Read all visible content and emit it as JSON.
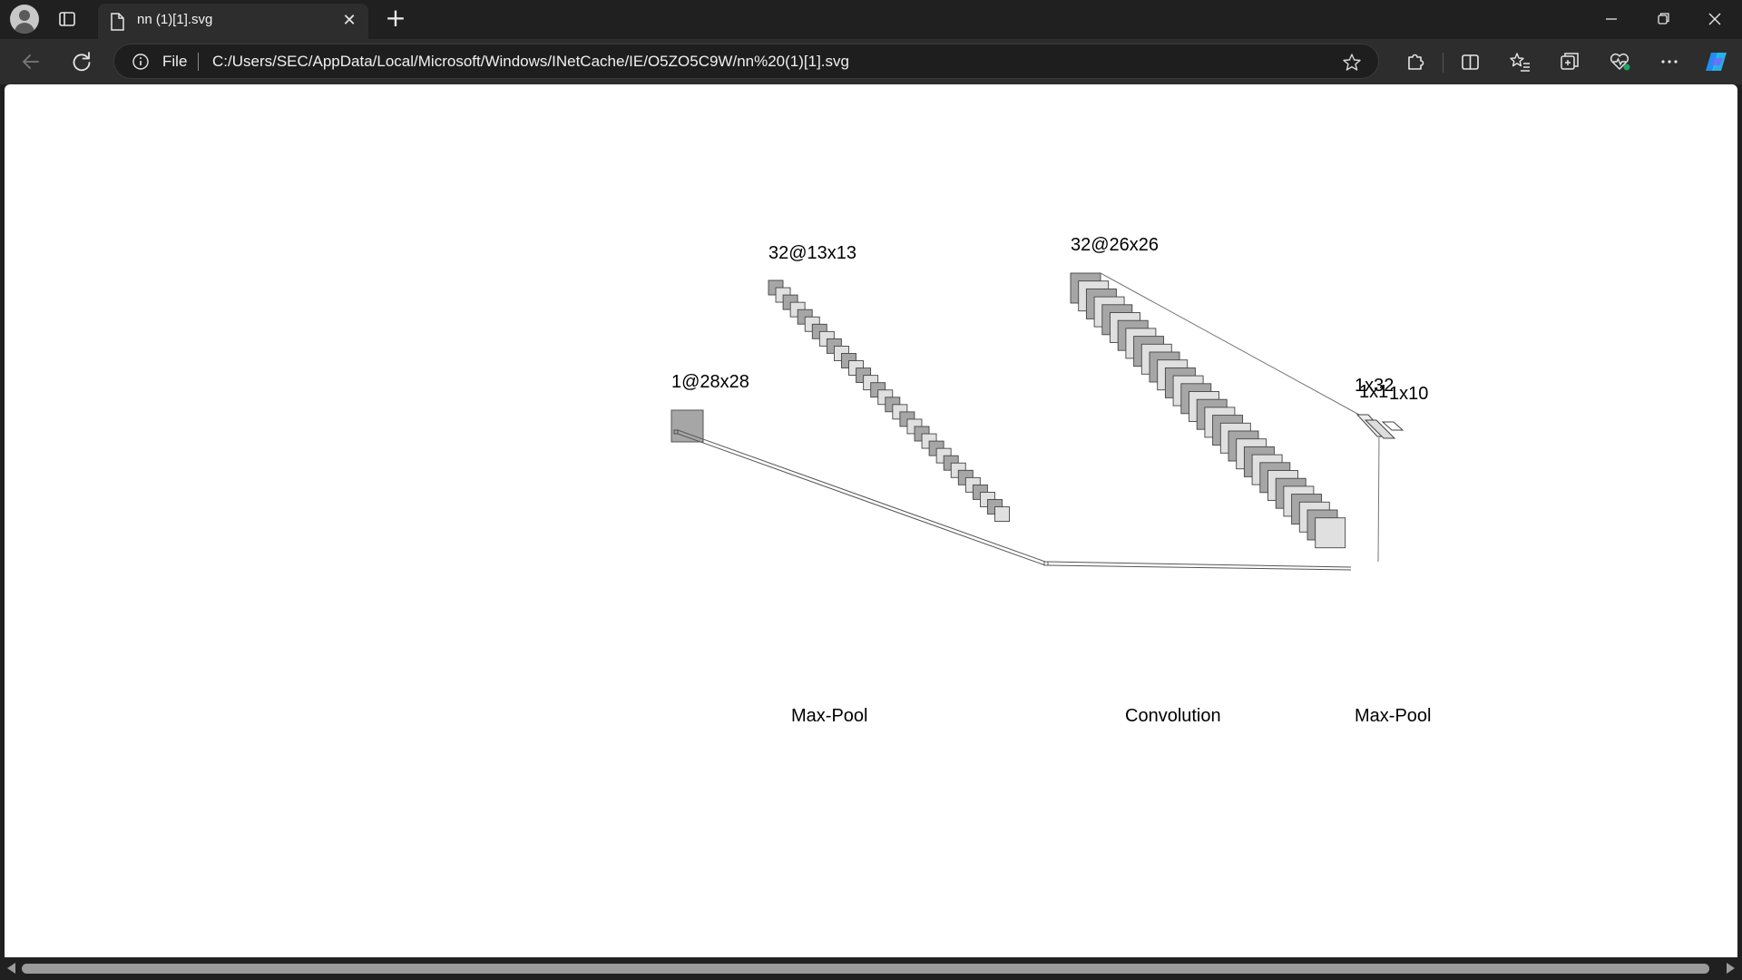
{
  "browser": {
    "tab_title": "nn (1)[1].svg",
    "new_tab_symbol": "+",
    "close_tab_symbol": "✕",
    "address": {
      "scheme_label": "File",
      "url": "C:/Users/SEC/AppData/Local/Microsoft/Windows/INetCache/IE/O5ZO5C9W/nn%20(1)[1].svg"
    },
    "accent_color": "#1f8ef1"
  },
  "diagram": {
    "layer_labels": [
      "1@28x28",
      "32@13x13",
      "32@26x26",
      "1x32",
      "1x1",
      "1x10"
    ],
    "operation_labels": [
      "Max-Pool",
      "Convolution",
      "Max-Pool"
    ],
    "map_fill_dark": "#a6a6a6",
    "map_fill_light": "#e0e0e0"
  },
  "icons": [
    "profile-icon",
    "tab-actions-icon",
    "file-icon",
    "back-icon",
    "refresh-icon",
    "info-icon",
    "favorite-star-icon",
    "extensions-icon",
    "split-screen-icon",
    "favorites-icon",
    "collections-icon",
    "browser-essentials-icon",
    "more-icon",
    "copilot-icon",
    "minimize-icon",
    "restore-icon",
    "close-icon"
  ]
}
